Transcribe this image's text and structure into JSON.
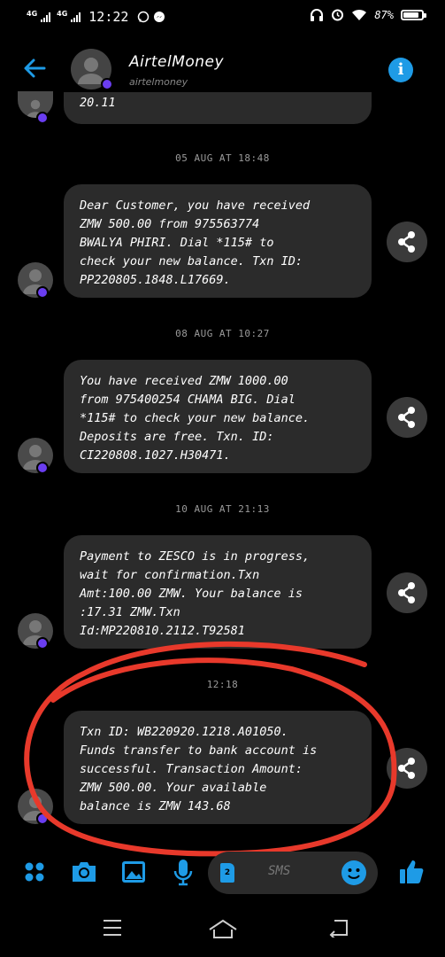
{
  "status_bar": {
    "network1": "4G",
    "network2": "4G",
    "time": "12:22",
    "battery": "87%",
    "battery_level": 0.87
  },
  "header": {
    "contact_name": "AirtelMoney",
    "contact_handle": "airtelmoney",
    "info_glyph": "i"
  },
  "previous_message_tail": "20.11",
  "messages": [
    {
      "date": "05 AUG AT 18:48",
      "lines": [
        "Dear Customer, you have received",
        "ZMW 500.00 from 975563774",
        "BWALYA PHIRI. Dial *115# to",
        "check your new balance. Txn ID:",
        "PP220805.1848.L17669."
      ]
    },
    {
      "date": "08 AUG AT 10:27",
      "lines": [
        "You have received ZMW 1000.00",
        "from 975400254 CHAMA BIG. Dial",
        "*115# to check your new balance.",
        "Deposits are free. Txn. ID:",
        "CI220808.1027.H30471."
      ]
    },
    {
      "date": "10 AUG AT 21:13",
      "lines": [
        "Payment to ZESCO is in progress,",
        "wait for confirmation.Txn",
        "Amt:100.00 ZMW. Your balance is",
        ":17.31 ZMW.Txn",
        "Id:MP220810.2112.T92581"
      ]
    },
    {
      "date": "12:18",
      "lines": [
        "Txn ID: WB220920.1218.A01050.",
        "Funds transfer to bank account is",
        "successful. Transaction Amount:",
        "ZMW 500.00. Your available",
        "balance is ZMW 143.68"
      ]
    }
  ],
  "composer": {
    "placeholder": "SMS",
    "sim_label": "2"
  },
  "colors": {
    "accent": "#1e9be6",
    "bubble": "#2b2b2b",
    "annotation": "#e8392b",
    "badge": "#6a3df0"
  }
}
